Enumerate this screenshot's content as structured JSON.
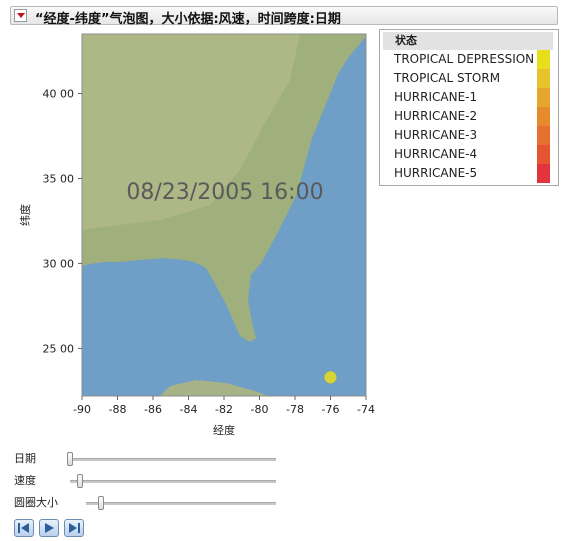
{
  "title": "“经度-纬度”气泡图，大小依据:风速，时间跨度:日期",
  "timestamp": "08/23/2005 16:00",
  "legend": {
    "title": "状态",
    "items": [
      {
        "label": "TROPICAL DEPRESSION",
        "color": "#e8df1c"
      },
      {
        "label": "TROPICAL STORM",
        "color": "#e8c22a"
      },
      {
        "label": "HURRICANE-1",
        "color": "#e6a52c"
      },
      {
        "label": "HURRICANE-2",
        "color": "#e78a2c"
      },
      {
        "label": "HURRICANE-3",
        "color": "#e6702e"
      },
      {
        "label": "HURRICANE-4",
        "color": "#e55532"
      },
      {
        "label": "HURRICANE-5",
        "color": "#e3333c"
      }
    ]
  },
  "chart_data": {
    "type": "scatter",
    "xlabel": "经度",
    "ylabel": "纬度",
    "xlim": [
      -90,
      -74
    ],
    "ylim": [
      22.2,
      43.5
    ],
    "x_ticks": [
      "-90",
      "-88",
      "-86",
      "-84",
      "-82",
      "-80",
      "-78",
      "-76",
      "-74"
    ],
    "y_ticks": [
      {
        "value": 25,
        "label": "25 00"
      },
      {
        "value": 30,
        "label": "30 00"
      },
      {
        "value": 35,
        "label": "35 00"
      },
      {
        "value": 40,
        "label": "40 00"
      }
    ],
    "points": [
      {
        "x": -76.0,
        "y": 23.3,
        "state": "TROPICAL DEPRESSION",
        "color": "#d9d436"
      }
    ]
  },
  "controls": {
    "sliders": [
      {
        "label": "日期",
        "value": 0.0
      },
      {
        "label": "速度",
        "value": 0.05
      },
      {
        "label": "圆圈大小",
        "value": 0.08
      }
    ],
    "buttons": [
      "step-back",
      "play",
      "step-forward"
    ]
  }
}
